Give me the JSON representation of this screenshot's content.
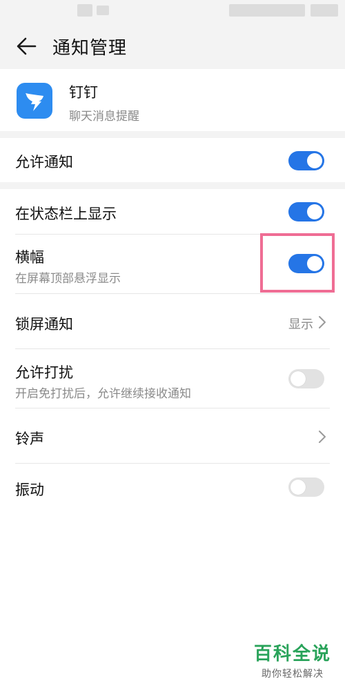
{
  "header": {
    "title": "通知管理"
  },
  "app": {
    "name": "钉钉",
    "description": "聊天消息提醒"
  },
  "settings": {
    "allow_notifications": {
      "label": "允许通知",
      "enabled": true
    },
    "show_in_status_bar": {
      "label": "在状态栏上显示",
      "enabled": true
    },
    "banner": {
      "label": "横幅",
      "sublabel": "在屏幕顶部悬浮显示",
      "enabled": true
    },
    "lock_screen": {
      "label": "锁屏通知",
      "value": "显示"
    },
    "allow_dnd": {
      "label": "允许打扰",
      "sublabel": "开启免打扰后，允许继续接收通知",
      "enabled": false
    },
    "ringtone": {
      "label": "铃声"
    },
    "vibration": {
      "label": "振动",
      "enabled": false
    }
  },
  "watermark": {
    "title": "百科全说",
    "subtitle": "助你轻松解决"
  },
  "colors": {
    "toggle_on": "#2575e6",
    "toggle_off": "#e2e2e2",
    "highlight": "#ef6d94",
    "app_icon": "#2d8cf0",
    "watermark": "#29a35a"
  }
}
